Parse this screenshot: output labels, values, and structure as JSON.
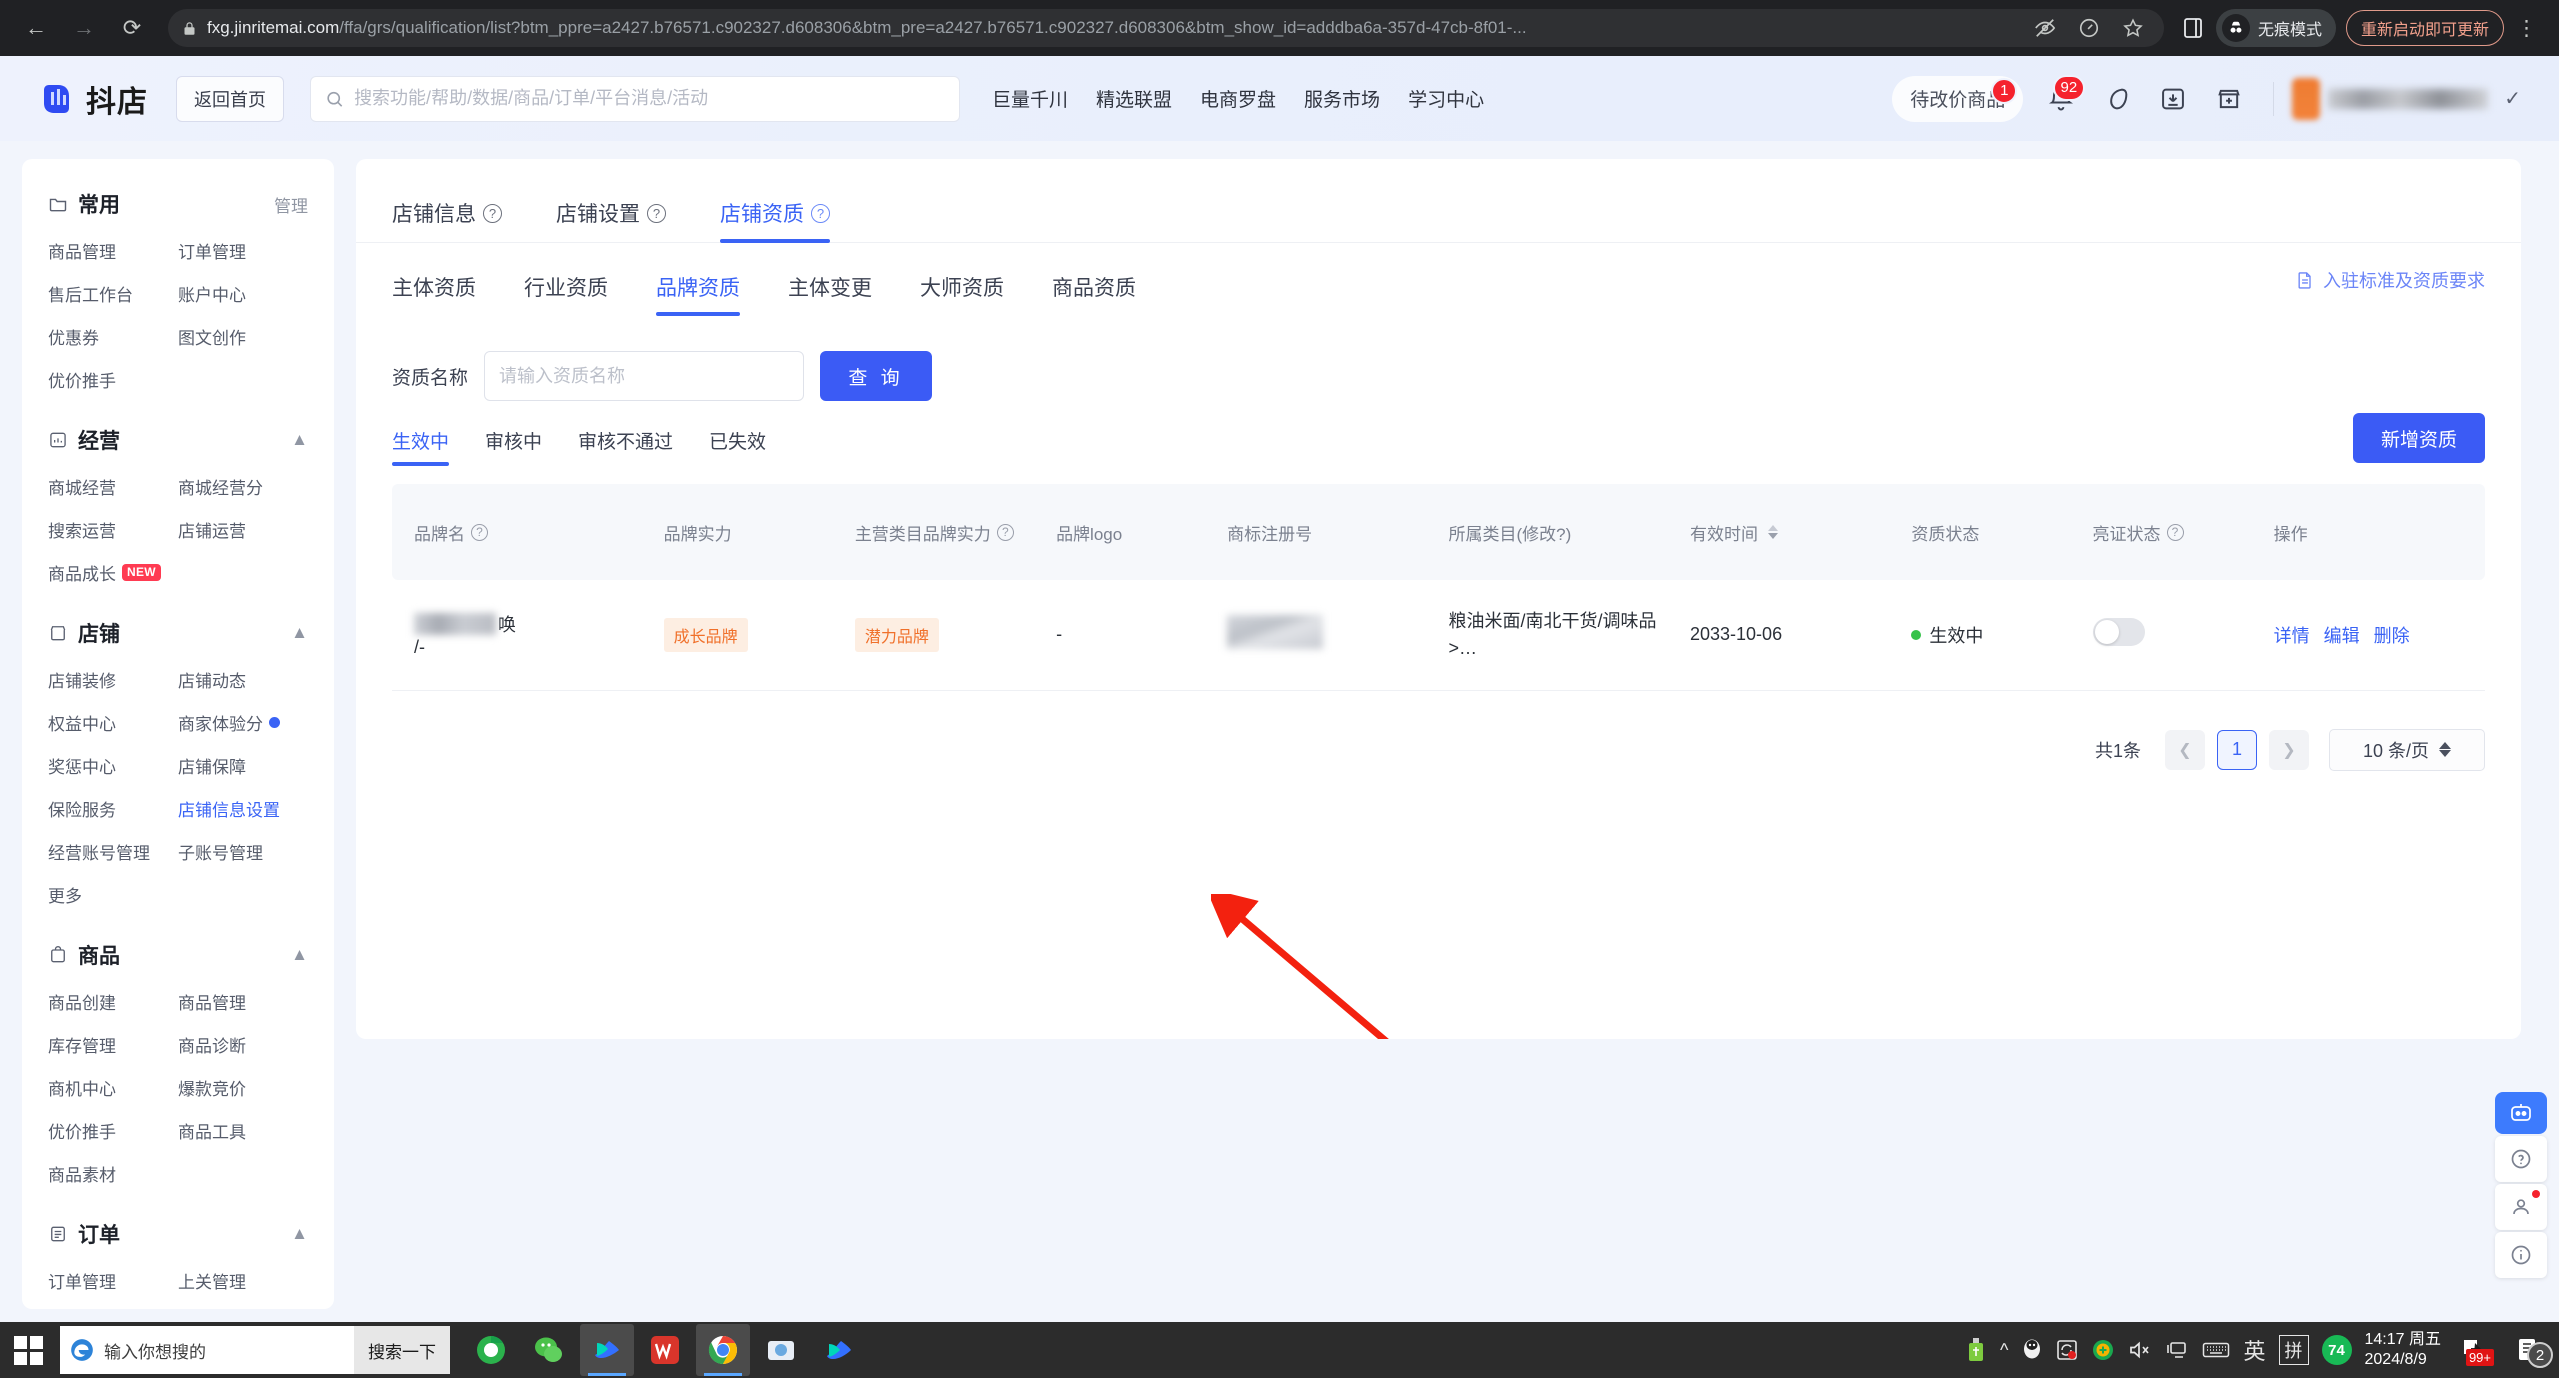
{
  "browser": {
    "back_icon": "back-arrow-icon",
    "forward_icon": "forward-arrow-icon",
    "reload_icon": "reload-icon",
    "url_domain": "fxg.jinritemai.com",
    "url_path": "/ffa/grs/qualification/list?btm_ppre=a2427.b76571.c902327.d608306&btm_pre=a2427.b76571.c902327.d608306&btm_show_id=adddba6a-357d-47cb-8f01-...",
    "incognito_label": "无痕模式",
    "update_label": "重新启动即可更新"
  },
  "header": {
    "logo_text": "抖店",
    "home_button": "返回首页",
    "search_placeholder": "搜索功能/帮助/数据/商品/订单/平台消息/活动",
    "nav": [
      "巨量千川",
      "精选联盟",
      "电商罗盘",
      "服务市场",
      "学习中心"
    ],
    "pending_label": "待改价商品",
    "pending_badge": "1",
    "bell_badge": "92"
  },
  "sidebar": {
    "groups": [
      {
        "title": "常用",
        "icon": "folder-icon",
        "right_action": "管理",
        "collapsible": false,
        "items": [
          {
            "label": "商品管理"
          },
          {
            "label": "订单管理"
          },
          {
            "label": "售后工作台"
          },
          {
            "label": "账户中心"
          },
          {
            "label": "优惠券"
          },
          {
            "label": "图文创作"
          },
          {
            "label": "优价推手"
          }
        ]
      },
      {
        "title": "经营",
        "icon": "chart-icon",
        "collapsible": true,
        "items": [
          {
            "label": "商城经营"
          },
          {
            "label": "商城经营分"
          },
          {
            "label": "搜索运营"
          },
          {
            "label": "店铺运营"
          },
          {
            "label": "商品成长",
            "tag": "NEW"
          }
        ]
      },
      {
        "title": "店铺",
        "icon": "shop-icon",
        "collapsible": true,
        "items": [
          {
            "label": "店铺装修"
          },
          {
            "label": "店铺动态"
          },
          {
            "label": "权益中心"
          },
          {
            "label": "商家体验分",
            "dot": true
          },
          {
            "label": "奖惩中心"
          },
          {
            "label": "店铺保障"
          },
          {
            "label": "保险服务"
          },
          {
            "label": "店铺信息设置",
            "active": true
          },
          {
            "label": "经营账号管理"
          },
          {
            "label": "子账号管理"
          },
          {
            "label": "更多"
          }
        ]
      },
      {
        "title": "商品",
        "icon": "bag-icon",
        "collapsible": true,
        "items": [
          {
            "label": "商品创建"
          },
          {
            "label": "商品管理"
          },
          {
            "label": "库存管理"
          },
          {
            "label": "商品诊断"
          },
          {
            "label": "商机中心"
          },
          {
            "label": "爆款竞价"
          },
          {
            "label": "优价推手"
          },
          {
            "label": "商品工具"
          },
          {
            "label": "商品素材"
          }
        ]
      },
      {
        "title": "订单",
        "icon": "list-icon",
        "collapsible": true,
        "items": [
          {
            "label": "订单管理"
          },
          {
            "label": "上关管理"
          }
        ]
      }
    ]
  },
  "main": {
    "tabs_level1": [
      {
        "label": "店铺信息",
        "help": true,
        "active": false
      },
      {
        "label": "店铺设置",
        "help": true,
        "active": false
      },
      {
        "label": "店铺资质",
        "help": true,
        "active": true
      }
    ],
    "tabs_level2": [
      {
        "label": "主体资质",
        "active": false
      },
      {
        "label": "行业资质",
        "active": false
      },
      {
        "label": "品牌资质",
        "active": true
      },
      {
        "label": "主体变更",
        "active": false
      },
      {
        "label": "大师资质",
        "active": false
      },
      {
        "label": "商品资质",
        "active": false
      }
    ],
    "requirements_link": "入驻标准及资质要求",
    "filter": {
      "label": "资质名称",
      "placeholder": "请输入资质名称",
      "value": "",
      "search_button": "查 询"
    },
    "status_tabs": [
      {
        "label": "生效中",
        "active": true
      },
      {
        "label": "审核中",
        "active": false
      },
      {
        "label": "审核不通过",
        "active": false
      },
      {
        "label": "已失效",
        "active": false
      }
    ],
    "add_button": "新增资质",
    "table": {
      "columns": [
        {
          "label": "品牌名",
          "help": true
        },
        {
          "label": "品牌实力",
          "help": false
        },
        {
          "label": "主营类目品牌实力",
          "help": true
        },
        {
          "label": "品牌logo",
          "help": false
        },
        {
          "label": "商标注册号",
          "help": false
        },
        {
          "label": "所属类目(修改?)",
          "help": false
        },
        {
          "label": "有效时间",
          "help": false,
          "sortable": true
        },
        {
          "label": "资质状态",
          "help": false
        },
        {
          "label": "亮证状态",
          "help": true
        },
        {
          "label": "操作",
          "help": false
        }
      ],
      "rows": [
        {
          "brand_name_suffix": "唤",
          "brand_name_second": "/-",
          "brand_strength": "成长品牌",
          "category_brand_strength": "潜力品牌",
          "brand_logo": "-",
          "trademark_no": "",
          "category": "粮油米面/南北干货/调味品 >…",
          "valid_time": "2033-10-06",
          "qualification_status": "生效中",
          "show_cert_toggle": false,
          "operations": [
            "详情",
            "编辑",
            "删除"
          ]
        }
      ]
    },
    "pagination": {
      "total": "共1条",
      "prev_icon": "chevron-left-icon",
      "current_page": "1",
      "next_icon": "chevron-right-icon",
      "page_size": "10 条/页"
    }
  },
  "taskbar": {
    "search_placeholder": "输入你想搜的",
    "search_button": "搜索一下",
    "clock_time": "14:17 周五",
    "clock_date": "2024/8/9",
    "battery_value": "74",
    "ime_label": "英",
    "ime_mode": "拼",
    "notif_badge": "99+",
    "action_badge": "2"
  }
}
